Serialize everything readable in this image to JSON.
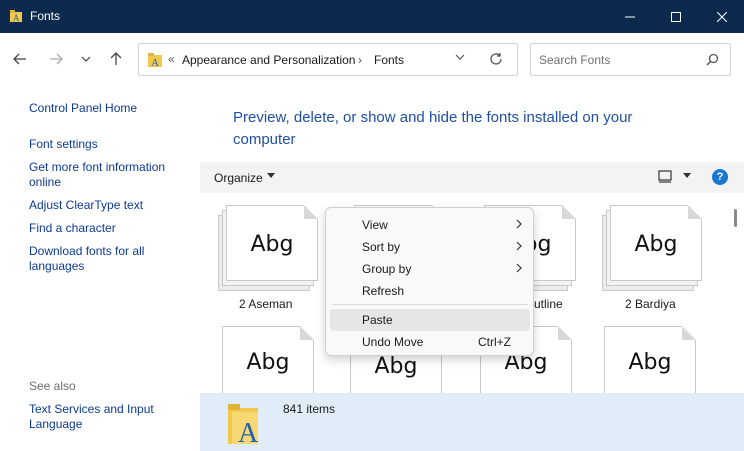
{
  "window": {
    "title": "Fonts"
  },
  "nav": {
    "breadcrumb_prefix": "«",
    "breadcrumbs": [
      "Appearance and Personalization",
      "Fonts"
    ],
    "separator": "›",
    "search_placeholder": "Search Fonts"
  },
  "sidebar": {
    "links": [
      "Control Panel Home",
      "Font settings",
      "Get more font information online",
      "Adjust ClearType text",
      "Find a character",
      "Download fonts for all languages"
    ],
    "see_also_label": "See also",
    "see_also_links": [
      "Text Services and Input Language"
    ]
  },
  "main": {
    "heading": "Preview, delete, or show and hide the fonts installed on your computer"
  },
  "toolbar": {
    "organize_label": "Organize",
    "help_label": "?"
  },
  "fonts": {
    "sample_text": "Abg",
    "row1": [
      {
        "label": "2  Aseman"
      },
      {
        "label": ""
      },
      {
        "label": "utline"
      },
      {
        "label": "2  Bardiya"
      }
    ]
  },
  "context_menu": {
    "items": [
      {
        "label": "View",
        "submenu": true
      },
      {
        "label": "Sort by",
        "submenu": true
      },
      {
        "label": "Group by",
        "submenu": true
      },
      {
        "label": "Refresh",
        "submenu": false
      },
      {
        "label": "Paste",
        "submenu": false,
        "highlighted": true
      },
      {
        "label": "Undo Move",
        "shortcut": "Ctrl+Z"
      }
    ]
  },
  "status": {
    "item_count": "841 items"
  },
  "colors": {
    "titlebar": "#0b2a4e",
    "link": "#0c3a94",
    "heading": "#1f4fa6",
    "statusbar": "#e1ecf9",
    "help_icon": "#1b78d0"
  }
}
